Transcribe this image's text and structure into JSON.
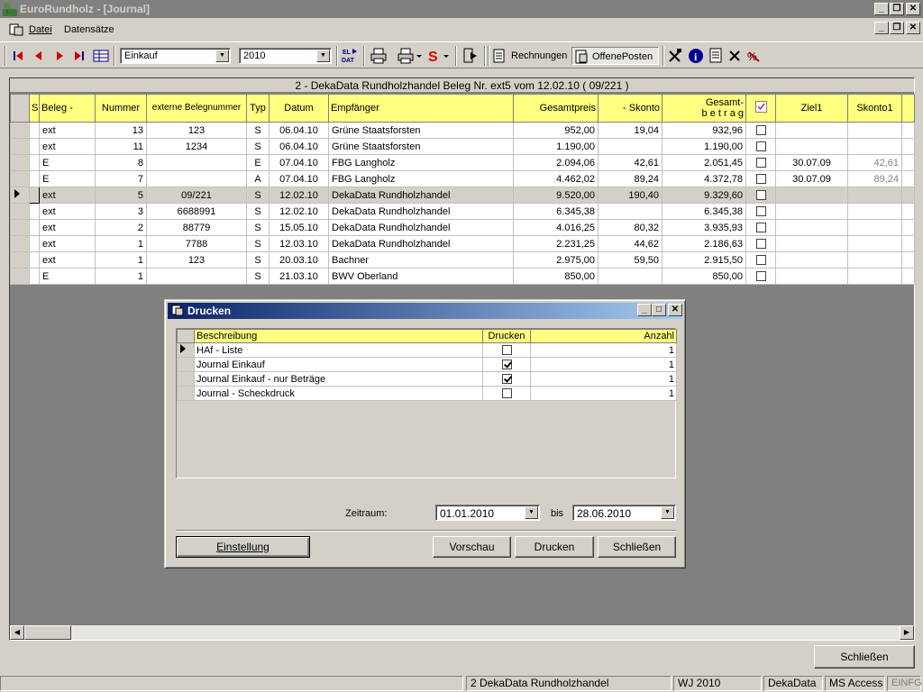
{
  "window": {
    "title": "EuroRundholz - [Journal]"
  },
  "menu": {
    "items": [
      "Datei",
      "Datensätze"
    ]
  },
  "toolbar": {
    "type_combo": "Einkauf",
    "year_combo": "2010",
    "eldat_label": "EL DAT",
    "rechnungen_label": "Rechnungen",
    "offeneposten_label": "OffenePosten"
  },
  "grid": {
    "caption": "2 - DekaData Rundholzhandel    Beleg Nr. ext5  vom 12.02.10    ( 09/221 )",
    "columns": {
      "s": "S",
      "beleg": "Beleg -",
      "nummer": "Nummer",
      "extern": "externe Belegnummer",
      "typ": "Typ",
      "datum": "Datum",
      "empf": "Empfänger",
      "gesamtpreis": "Gesamtpreis",
      "skonto": "- Skonto",
      "betrag_1": "Gesamt-",
      "betrag_2": "b e t r a g",
      "ziel1": "Ziel1",
      "skonto1": "Skonto1"
    },
    "rows": [
      {
        "beleg": "ext",
        "nummer": "13",
        "extern": "123",
        "typ": "S",
        "datum": "06.04.10",
        "empf": "Grüne Staatsforsten",
        "gesamtpreis": "952,00",
        "skonto": "19,04",
        "betrag": "932,96",
        "ziel1": "",
        "skonto1": ""
      },
      {
        "beleg": "ext",
        "nummer": "11",
        "extern": "1234",
        "typ": "S",
        "datum": "06.04.10",
        "empf": "Grüne Staatsforsten",
        "gesamtpreis": "1.190,00",
        "skonto": "",
        "betrag": "1.190,00",
        "ziel1": "",
        "skonto1": ""
      },
      {
        "beleg": "E",
        "nummer": "8",
        "extern": "",
        "typ": "E",
        "datum": "07.04.10",
        "empf": "FBG Langholz",
        "gesamtpreis": "2.094,06",
        "skonto": "42,61",
        "betrag": "2.051,45",
        "ziel1": "30.07.09",
        "skonto1": "42,61"
      },
      {
        "beleg": "E",
        "nummer": "7",
        "extern": "",
        "typ": "A",
        "datum": "07.04.10",
        "empf": "FBG Langholz",
        "gesamtpreis": "4.462,02",
        "skonto": "89,24",
        "betrag": "4.372,78",
        "ziel1": "30.07.09",
        "skonto1": "89,24"
      },
      {
        "beleg": "ext",
        "nummer": "5",
        "extern": "09/221",
        "typ": "S",
        "datum": "12.02.10",
        "empf": "DekaData Rundholzhandel",
        "gesamtpreis": "9.520,00",
        "skonto": "190,40",
        "betrag": "9.329,60",
        "ziel1": "",
        "skonto1": ""
      },
      {
        "beleg": "ext",
        "nummer": "3",
        "extern": "6688991",
        "typ": "S",
        "datum": "12.02.10",
        "empf": "DekaData Rundholzhandel",
        "gesamtpreis": "6.345,38",
        "skonto": "",
        "betrag": "6.345,38",
        "ziel1": "",
        "skonto1": ""
      },
      {
        "beleg": "ext",
        "nummer": "2",
        "extern": "88779",
        "typ": "S",
        "datum": "15.05.10",
        "empf": "DekaData Rundholzhandel",
        "gesamtpreis": "4.016,25",
        "skonto": "80,32",
        "betrag": "3.935,93",
        "ziel1": "",
        "skonto1": ""
      },
      {
        "beleg": "ext",
        "nummer": "1",
        "extern": "7788",
        "typ": "S",
        "datum": "12.03.10",
        "empf": "DekaData Rundholzhandel",
        "gesamtpreis": "2.231,25",
        "skonto": "44,62",
        "betrag": "2.186,63",
        "ziel1": "",
        "skonto1": ""
      },
      {
        "beleg": "ext",
        "nummer": "1",
        "extern": "123",
        "typ": "S",
        "datum": "20.03.10",
        "empf": "Bachner",
        "gesamtpreis": "2.975,00",
        "skonto": "59,50",
        "betrag": "2.915,50",
        "ziel1": "",
        "skonto1": ""
      },
      {
        "beleg": "E",
        "nummer": "1",
        "extern": "",
        "typ": "S",
        "datum": "21.03.10",
        "empf": "BWV Oberland",
        "gesamtpreis": "850,00",
        "skonto": "",
        "betrag": "850,00",
        "ziel1": "",
        "skonto1": ""
      }
    ]
  },
  "dialog": {
    "title": "Drucken",
    "columns": {
      "beschreibung": "Beschreibung",
      "drucken": "Drucken",
      "anzahl": "Anzahl"
    },
    "rows": [
      {
        "beschreibung": "HAf - Liste",
        "drucken": false,
        "anzahl": "1"
      },
      {
        "beschreibung": "Journal   Einkauf",
        "drucken": true,
        "anzahl": "1"
      },
      {
        "beschreibung": "Journal   Einkauf - nur Beträge",
        "drucken": true,
        "anzahl": "1"
      },
      {
        "beschreibung": "Journal - Scheckdruck",
        "drucken": false,
        "anzahl": "1"
      }
    ],
    "zeitraum_label": "Zeitraum:",
    "date_from": "01.01.2010",
    "bis_label": "bis",
    "date_to": "28.06.2010",
    "einstellung_label": "Einstellung",
    "vorschau_label": "Vorschau",
    "drucken_label": "Drucken",
    "schliessen_label": "Schließen"
  },
  "schliessen_label": "Schließen",
  "status": {
    "company": "2 DekaData Rundholzhandel",
    "wj": "WJ 2010",
    "db": "DekaData",
    "engine": "MS Access",
    "mode": "EINFG"
  },
  "colors": {
    "header_yellow": "#ffff80",
    "dialog_title_start": "#0a246a",
    "dialog_title_end": "#a6caf0",
    "inactive_title": "#808080"
  }
}
